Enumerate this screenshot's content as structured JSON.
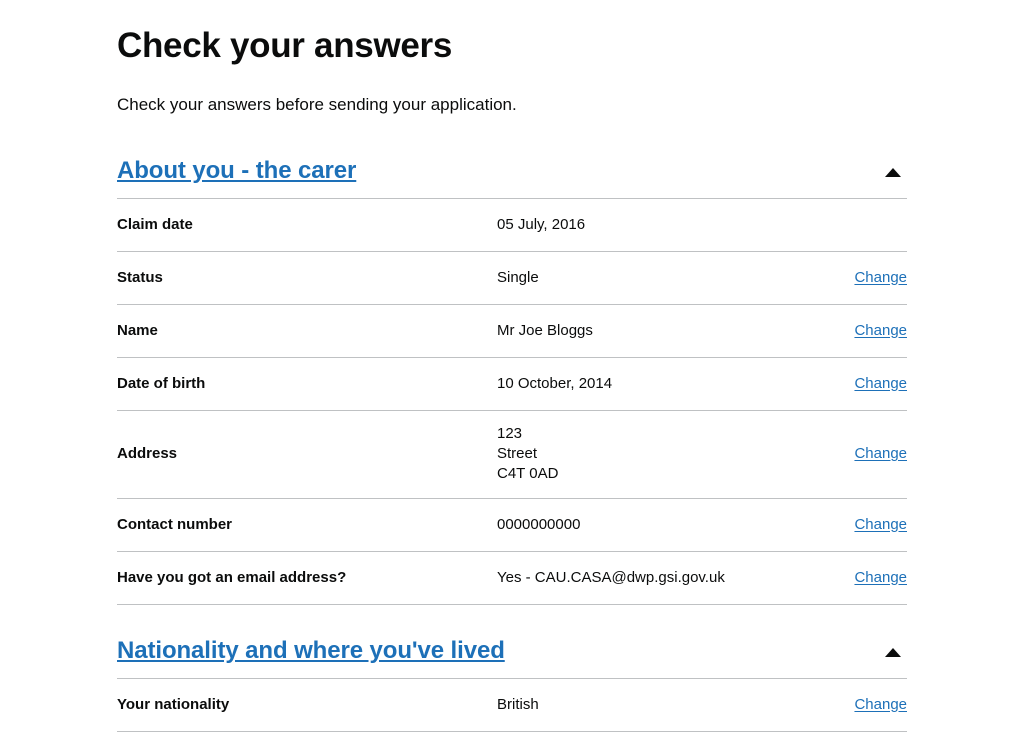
{
  "page": {
    "title": "Check your answers",
    "lede": "Check your answers before sending your application."
  },
  "icons": {
    "collapse": "triangle-up-icon"
  },
  "colors": {
    "link": "#1d70b8",
    "text": "#0b0c0c",
    "border": "#bfc1c3",
    "background": "#ffffff"
  },
  "change_label": "Change",
  "sections": [
    {
      "heading": "About you - the carer",
      "expanded": true,
      "rows": [
        {
          "key": "Claim date",
          "value": "05 July, 2016",
          "action": "",
          "tall": false
        },
        {
          "key": "Status",
          "value": "Single",
          "action": "Change",
          "tall": false
        },
        {
          "key": "Name",
          "value": "Mr Joe Bloggs",
          "action": "Change",
          "tall": false
        },
        {
          "key": "Date of birth",
          "value": "10 October, 2014",
          "action": "Change",
          "tall": false
        },
        {
          "key": "Address",
          "value": "123\nStreet\nC4T 0AD",
          "action": "Change",
          "tall": true
        },
        {
          "key": "Contact number",
          "value": "0000000000",
          "action": "Change",
          "tall": false
        },
        {
          "key": "Have you got an email address?",
          "value": "Yes - CAU.CASA@dwp.gsi.gov.uk",
          "action": "Change",
          "tall": false
        }
      ]
    },
    {
      "heading": "Nationality and where you've lived",
      "expanded": true,
      "rows": [
        {
          "key": "Your nationality",
          "value": "British",
          "action": "Change",
          "tall": false
        }
      ]
    }
  ]
}
